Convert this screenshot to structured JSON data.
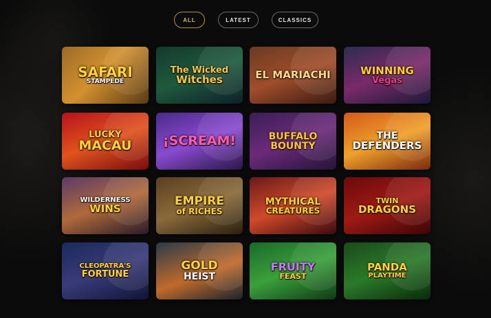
{
  "filters": {
    "all": "ALL",
    "latest": "LATEST",
    "classics": "CLASSICS",
    "active": "all"
  },
  "games": [
    {
      "line1": "SAFARI",
      "line2": "STAMPEDE",
      "bg": "linear-gradient(135deg,#9b6a2a,#d3912f 45%,#5a3a16)",
      "c1": "#ffd23a",
      "c2": "#ffffff",
      "s1": "20px",
      "s2": "9px"
    },
    {
      "line1": "The Wicked",
      "line2": "Witches",
      "bg": "linear-gradient(160deg,#143a2c,#1e5a3d 50%,#0f1f2a)",
      "c1": "#f3c84b",
      "c2": "#f3c84b",
      "s1": "13px",
      "s2": "15px"
    },
    {
      "line1": "",
      "line2": "EL MARIACHI",
      "bg": "linear-gradient(160deg,#6b3b22,#a04d2a 50%,#3a1b12)",
      "c1": "#ffd98a",
      "c2": "#ffd98a",
      "s1": "8px",
      "s2": "15px"
    },
    {
      "line1": "WINNING",
      "line2": "Vegas",
      "bg": "linear-gradient(160deg,#2c2c4e,#7a2a6a 50%,#1a1a36)",
      "c1": "#ffcc33",
      "c2": "#e83c8a",
      "s1": "15px",
      "s2": "13px"
    },
    {
      "line1": "LUCKY",
      "line2": "MACAU",
      "bg": "linear-gradient(160deg,#b5121b,#e0531d 50%,#7a0c10)",
      "c1": "#ffd23a",
      "c2": "#ffd23a",
      "s1": "13px",
      "s2": "19px"
    },
    {
      "line1": "¡SCREAM!",
      "line2": "",
      "bg": "linear-gradient(160deg,#4a2a8a,#8a4ad0 50%,#2a184a)",
      "c1": "#ff5cb0",
      "c2": "#ffffff",
      "s1": "19px",
      "s2": "8px"
    },
    {
      "line1": "BUFFALO",
      "line2": "BOUNTY",
      "bg": "linear-gradient(160deg,#3a1f55,#6c2a7a 50%,#241436)",
      "c1": "#ffc53a",
      "c2": "#ffc53a",
      "s1": "14px",
      "s2": "14px"
    },
    {
      "line1": "THE",
      "line2": "DEFENDERS",
      "bg": "linear-gradient(160deg,#d25a1b,#f0a02a 50%,#7a2a10)",
      "c1": "#ffffff",
      "c2": "#ffffff",
      "s1": "14px",
      "s2": "15px"
    },
    {
      "line1": "WILDERNESS",
      "line2": "WINS",
      "bg": "linear-gradient(160deg,#5a3a6a,#b06a3a 50%,#2a1a2a)",
      "c1": "#ffffff",
      "c2": "#ffd23a",
      "s1": "10px",
      "s2": "15px"
    },
    {
      "line1": "EMPIRE",
      "line2": "of RICHES",
      "bg": "linear-gradient(160deg,#5a4020,#8a6a3a 50%,#2a2010)",
      "c1": "#ffd23a",
      "c2": "#ffd23a",
      "s1": "17px",
      "s2": "12px"
    },
    {
      "line1": "MYTHICAL",
      "line2": "CREATURES",
      "bg": "linear-gradient(160deg,#6a1a1a,#d04a2a 50%,#3a0a10)",
      "c1": "#ffd23a",
      "c2": "#ffd23a",
      "s1": "14px",
      "s2": "12px"
    },
    {
      "line1": "TWIN",
      "line2": "DRAGONS",
      "bg": "linear-gradient(160deg,#6a0a0a,#a01a14 50%,#3a0606)",
      "c1": "#ffd23a",
      "c2": "#ffd23a",
      "s1": "11px",
      "s2": "15px"
    },
    {
      "line1": "CLEOPATRA'S",
      "line2": "FORTUNE",
      "bg": "linear-gradient(160deg,#1a2a5a,#3a3a7a 50%,#0f1636)",
      "c1": "#ffd23a",
      "c2": "#ffd23a",
      "s1": "10px",
      "s2": "13px"
    },
    {
      "line1": "GOLD",
      "line2": "HEIST",
      "bg": "linear-gradient(160deg,#2a3a4a,#c06a2a 55%,#1a2430)",
      "c1": "#ffd23a",
      "c2": "#ffffff",
      "s1": "17px",
      "s2": "14px"
    },
    {
      "line1": "FRUITY",
      "line2": "FEAST",
      "bg": "linear-gradient(160deg,#1a6a2a,#3aa03a 50%,#0f3a18)",
      "c1": "#c07aff",
      "c2": "#ffd23a",
      "s1": "16px",
      "s2": "11px"
    },
    {
      "line1": "PANDA",
      "line2": "PLAYTIME",
      "bg": "linear-gradient(160deg,#1a4a1a,#2a7a2a 50%,#0a2a0a)",
      "c1": "#ffd23a",
      "c2": "#ffd23a",
      "s1": "15px",
      "s2": "10px"
    }
  ]
}
